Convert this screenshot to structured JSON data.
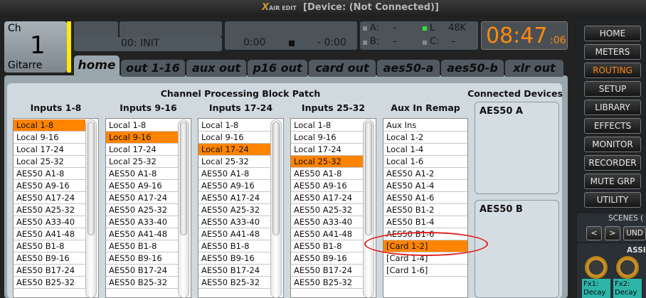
{
  "titlebar": {
    "logo": "X",
    "logo_suffix": "AIR EDIT",
    "title": "[Device: (Not Connected)]"
  },
  "channel": {
    "label": "Ch",
    "number": "1",
    "name": "Gitarre"
  },
  "display": {
    "scene_text": "00: INIT",
    "time_left": "0:00",
    "time_right": "- 0:00",
    "a": "A:",
    "a_val": "–",
    "b": "B:",
    "b_val": "–",
    "l": "L",
    "l_val": "48K",
    "c": "C:",
    "c_val": "–"
  },
  "clock": {
    "time": "08:47",
    "seconds": ":06"
  },
  "tabs": [
    "home",
    "out 1-16",
    "aux out",
    "p16 out",
    "card out",
    "aes50-a",
    "aes50-b",
    "xlr out"
  ],
  "patch": {
    "title": "Channel Processing Block Patch",
    "columns": [
      {
        "heading": "Inputs 1-8",
        "selected": 0,
        "items": [
          "Local 1-8",
          "Local 9-16",
          "Local 17-24",
          "Local 25-32",
          "AES50 A1-8",
          "AES50 A9-16",
          "AES50 A17-24",
          "AES50 A25-32",
          "AES50 A33-40",
          "AES50 A41-48",
          "AES50 B1-8",
          "AES50 B9-16",
          "AES50 B17-24",
          "AES50 B25-32"
        ]
      },
      {
        "heading": "Inputs 9-16",
        "selected": 1,
        "items": [
          "Local 1-8",
          "Local 9-16",
          "Local 17-24",
          "Local 25-32",
          "AES50 A1-8",
          "AES50 A9-16",
          "AES50 A17-24",
          "AES50 A25-32",
          "AES50 A33-40",
          "AES50 A41-48",
          "AES50 B1-8",
          "AES50 B9-16",
          "AES50 B17-24",
          "AES50 B25-32"
        ]
      },
      {
        "heading": "Inputs 17-24",
        "selected": 2,
        "items": [
          "Local 1-8",
          "Local 9-16",
          "Local 17-24",
          "Local 25-32",
          "AES50 A1-8",
          "AES50 A9-16",
          "AES50 A17-24",
          "AES50 A25-32",
          "AES50 A33-40",
          "AES50 A41-48",
          "AES50 B1-8",
          "AES50 B9-16",
          "AES50 B17-24",
          "AES50 B25-32"
        ]
      },
      {
        "heading": "Inputs 25-32",
        "selected": 3,
        "items": [
          "Local 1-8",
          "Local 9-16",
          "Local 17-24",
          "Local 25-32",
          "AES50 A1-8",
          "AES50 A9-16",
          "AES50 A17-24",
          "AES50 A25-32",
          "AES50 A33-40",
          "AES50 A41-48",
          "AES50 B1-8",
          "AES50 B9-16",
          "AES50 B17-24",
          "AES50 B25-32"
        ]
      }
    ],
    "aux": {
      "heading": "Aux In Remap",
      "selected": 10,
      "items": [
        "Aux Ins",
        "Local 1-2",
        "Local 1-4",
        "Local 1-6",
        "AES50 A1-2",
        "AES50 A1-4",
        "AES50 A1-6",
        "AES50 B1-2",
        "AES50 B1-4",
        "AES50 B1-6",
        "[Card 1-2]",
        "[Card 1-4]",
        "[Card 1-6]"
      ]
    }
  },
  "devices": {
    "heading": "Connected Devices",
    "a": "AES50 A",
    "b": "AES50 B"
  },
  "nav": [
    "HOME",
    "METERS",
    "ROUTING",
    "SETUP",
    "LIBRARY",
    "EFFECTS",
    "MONITOR",
    "RECORDER",
    "MUTE GRP",
    "UTILITY"
  ],
  "nav_active": "ROUTING",
  "scenes": {
    "label": "SCENES (",
    "prev": "<",
    "next": ">",
    "undo": "UND"
  },
  "assign": {
    "label": "ASSIG",
    "fx1": "Fx1:\nDecay",
    "fx2": "Fx2:\nDecay"
  },
  "colors": {
    "accent": "#ff8400",
    "clock": "#ff8a10",
    "annotation": "#e0201e"
  }
}
